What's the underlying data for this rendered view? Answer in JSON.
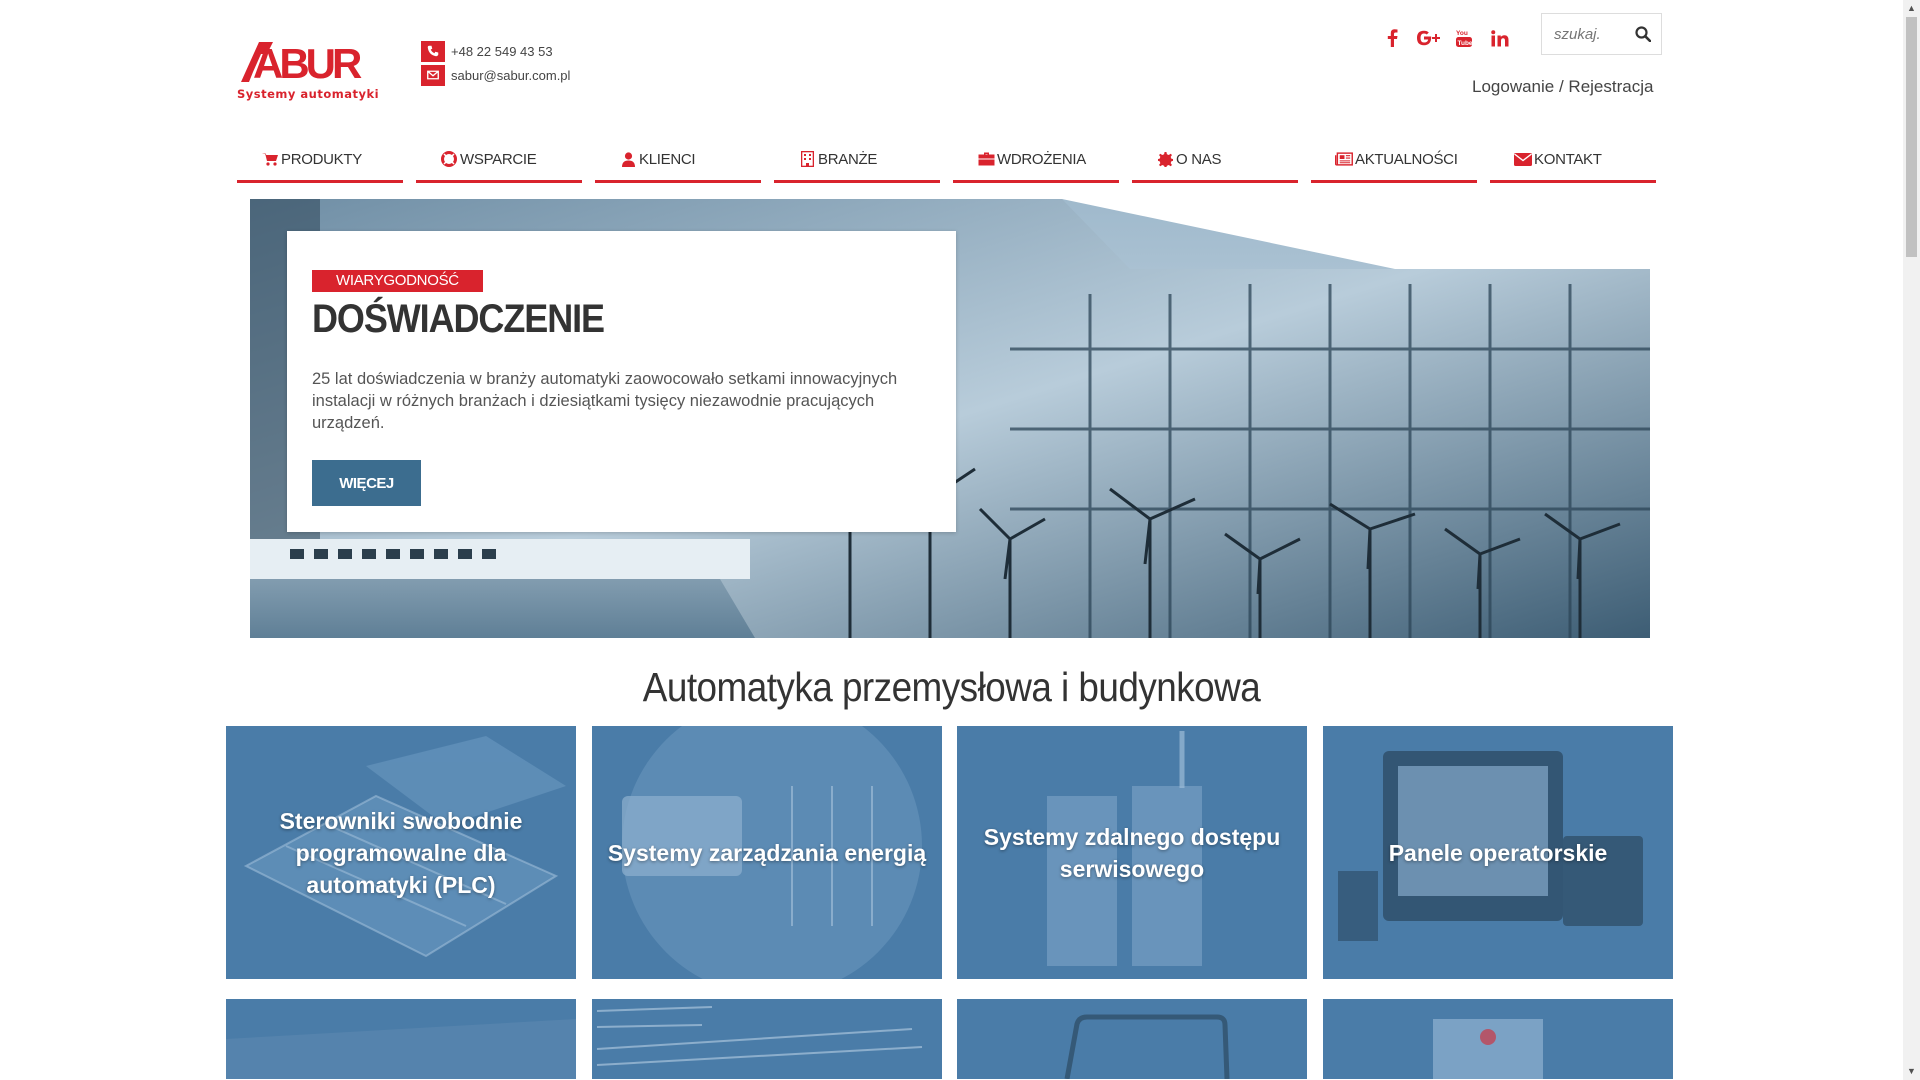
{
  "header": {
    "logo_text": "SABUR",
    "logo_tagline": "Systemy automatyki",
    "phone": "+48 22 549 43 53",
    "email": "sabur@sabur.com.pl",
    "social": [
      {
        "name": "facebook-icon",
        "glyph": "f"
      },
      {
        "name": "google-plus-icon",
        "glyph": "G+"
      },
      {
        "name": "youtube-icon",
        "glyph": "You"
      },
      {
        "name": "linkedin-icon",
        "glyph": "in"
      }
    ],
    "search_placeholder": "szukaj.",
    "login_label": "Logowanie",
    "login_sep": " / ",
    "register_label": "Rejestracja"
  },
  "nav": [
    {
      "label": "PRODUKTY",
      "icon": "cart-icon"
    },
    {
      "label": "WSPARCIE",
      "icon": "lifebuoy-icon"
    },
    {
      "label": "KLIENCI",
      "icon": "user-icon"
    },
    {
      "label": "BRANŻE",
      "icon": "building-icon"
    },
    {
      "label": "WDROŻENIA",
      "icon": "briefcase-icon"
    },
    {
      "label": "O NAS",
      "icon": "gear-icon"
    },
    {
      "label": "AKTUALNOŚCI",
      "icon": "newspaper-icon"
    },
    {
      "label": "KONTAKT",
      "icon": "envelope-icon"
    }
  ],
  "hero": {
    "badge": "WIARYGODNOŚĆ",
    "title": "DOŚWIADCZENIE",
    "text": "25 lat doświadczenia w branży automatyki zaowocowało setkami innowacyjnych instalacji w różnych branżach i dziesiątkami tysięcy niezawodnie pracujących urządzeń.",
    "button": "WIĘCEJ"
  },
  "section": {
    "title": "Automatyka przemysłowa i budynkowa",
    "tiles": [
      {
        "label": "Sterowniki swobodnie programowalne dla automatyki (PLC)"
      },
      {
        "label": "Systemy zarządzania energią"
      },
      {
        "label": "Systemy zdalnego dostępu serwisowego"
      },
      {
        "label": "Panele operatorskie"
      }
    ]
  },
  "colors": {
    "accent": "#d9232d",
    "button": "#3c6d8f",
    "tile": "#4a7ca8"
  }
}
